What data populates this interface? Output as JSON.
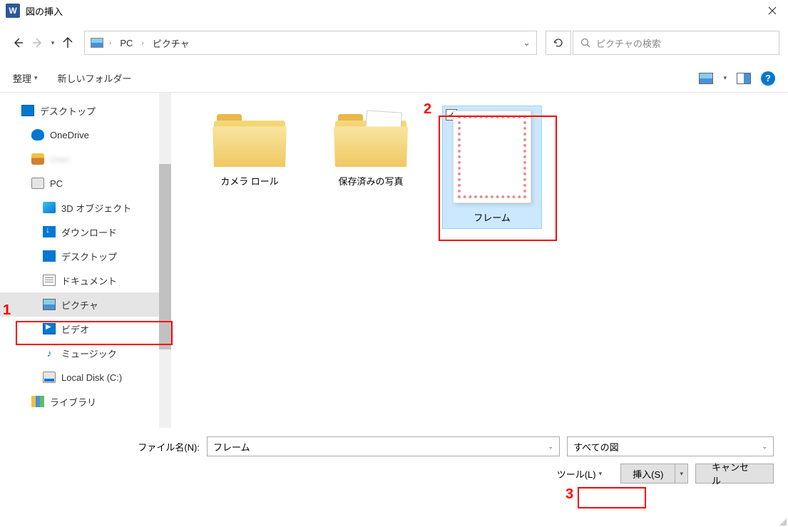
{
  "titlebar": {
    "title": "図の挿入"
  },
  "breadcrumb": {
    "root": "PC",
    "current": "ピクチャ"
  },
  "search": {
    "placeholder": "ピクチャの検索"
  },
  "toolbar": {
    "organize": "整理",
    "new_folder": "新しいフォルダー"
  },
  "sidebar": {
    "desktop": "デスクトップ",
    "onedrive": "OneDrive",
    "user": "User",
    "pc": "PC",
    "objects3d": "3D オブジェクト",
    "downloads": "ダウンロード",
    "desktop2": "デスクトップ",
    "documents": "ドキュメント",
    "pictures": "ピクチャ",
    "videos": "ビデオ",
    "music": "ミュージック",
    "localdisk": "Local Disk (C:)",
    "library": "ライブラリ"
  },
  "files": {
    "camera_roll": "カメラ ロール",
    "saved_pictures": "保存済みの写真",
    "frame": "フレーム"
  },
  "bottom": {
    "filename_label": "ファイル名(N):",
    "filename_value": "フレーム",
    "filter": "すべての図",
    "tools": "ツール(L)",
    "insert": "挿入(S)",
    "cancel": "キャンセル"
  },
  "annotations": {
    "n1": "1",
    "n2": "2",
    "n3": "3"
  }
}
